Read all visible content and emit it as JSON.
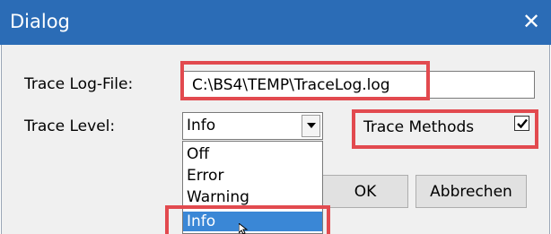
{
  "window": {
    "title": "Dialog",
    "close_glyph": "✕"
  },
  "form": {
    "logfile_label": "Trace Log-File:",
    "logfile_value": "C:\\BS4\\TEMP\\TraceLog.log",
    "level_label": "Trace Level:",
    "level_value": "Info",
    "methods_label": "Trace Methods",
    "methods_checked": true
  },
  "dropdown": {
    "options": [
      "Off",
      "Error",
      "Warning",
      "Info"
    ],
    "selected": "Info"
  },
  "buttons": {
    "ok": "OK",
    "cancel": "Abbrechen"
  },
  "colors": {
    "titlebar": "#2b6cb6",
    "highlight": "#e24a4f",
    "selection": "#3a87d6"
  },
  "icons": {
    "combo_arrow": "chevron-down-icon",
    "checkbox_mark": "check-icon",
    "pointer": "mouse-cursor-icon"
  }
}
